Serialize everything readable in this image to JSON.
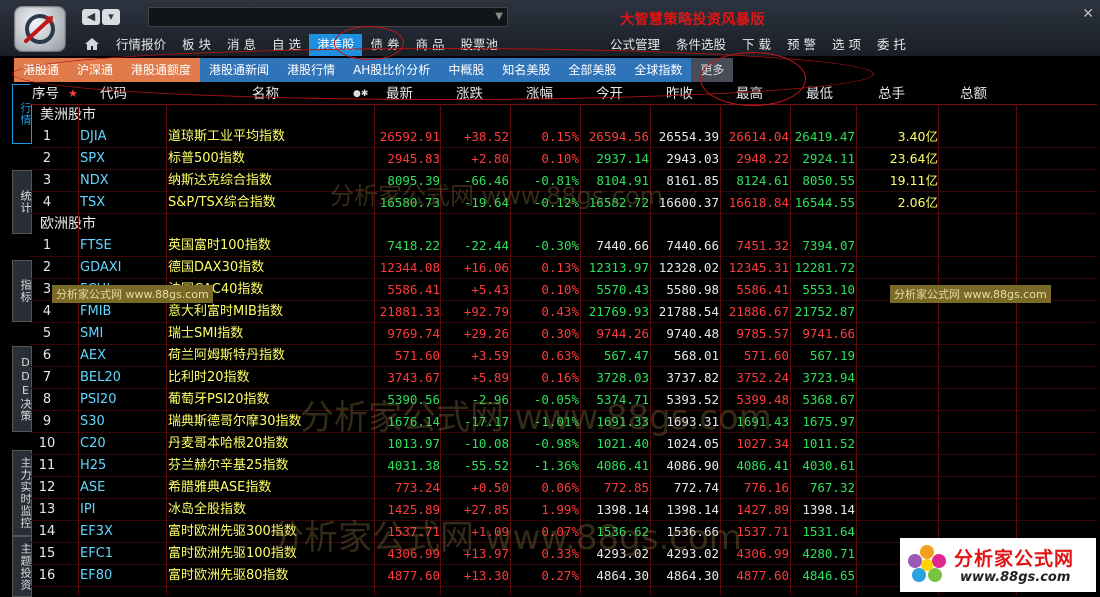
{
  "app": {
    "title": "大智慧策略投资风暴版"
  },
  "menu": [
    "行情报价",
    "板 块",
    "消 息",
    "自 选",
    "港美股",
    "债 券",
    "商 品",
    "股票池",
    "公式管理",
    "条件选股",
    "下 载",
    "预 警",
    "选 项",
    "委 托"
  ],
  "active_menu": "港美股",
  "subtabs": [
    {
      "label": "港股通",
      "style": "orange"
    },
    {
      "label": "沪深通",
      "style": "orange"
    },
    {
      "label": "港股通额度",
      "style": "orange"
    },
    {
      "label": "港股通新闻",
      "style": "blue"
    },
    {
      "label": "港股行情",
      "style": "blue"
    },
    {
      "label": "AH股比价分析",
      "style": "blue"
    },
    {
      "label": "中概股",
      "style": "blue"
    },
    {
      "label": "知名美股",
      "style": "blue"
    },
    {
      "label": "全部美股",
      "style": "blue"
    },
    {
      "label": "全球指数",
      "style": "blue"
    },
    {
      "label": "更多",
      "style": "more"
    }
  ],
  "side_tabs": [
    {
      "label": "行情",
      "active": true
    },
    {
      "label": "统计",
      "active": false
    },
    {
      "label": "指标",
      "active": false
    },
    {
      "label": "DDE决策",
      "active": false
    },
    {
      "label": "主力实时监控",
      "active": false
    },
    {
      "label": "主题投资",
      "active": false
    }
  ],
  "table": {
    "columns": [
      "序号",
      "代码",
      "名称",
      "最新",
      "涨跌",
      "涨幅",
      "今开",
      "昨收",
      "最高",
      "最低",
      "总手",
      "总额"
    ],
    "sections": [
      {
        "title": "美洲股市",
        "rows": [
          {
            "no": "1",
            "code": "DJIA",
            "name": "道琼斯工业平均指数",
            "last": "26592.91",
            "chg": "+38.52",
            "pct": "0.15%",
            "open": "26594.56",
            "prev": "26554.39",
            "high": "26614.04",
            "low": "26419.47",
            "vol": "3.40亿",
            "dir": "up"
          },
          {
            "no": "2",
            "code": "SPX",
            "name": "标普500指数",
            "last": "2945.83",
            "chg": "+2.80",
            "pct": "0.10%",
            "open": "2937.14",
            "prev": "2943.03",
            "high": "2948.22",
            "low": "2924.11",
            "vol": "23.64亿",
            "dir": "up"
          },
          {
            "no": "3",
            "code": "NDX",
            "name": "纳斯达克综合指数",
            "last": "8095.39",
            "chg": "-66.46",
            "pct": "-0.81%",
            "open": "8104.91",
            "prev": "8161.85",
            "high": "8124.61",
            "low": "8050.55",
            "vol": "19.11亿",
            "dir": "down"
          },
          {
            "no": "4",
            "code": "TSX",
            "name": "S&P/TSX综合指数",
            "last": "16580.73",
            "chg": "-19.64",
            "pct": "-0.12%",
            "open": "16582.72",
            "prev": "16600.37",
            "high": "16618.84",
            "low": "16544.55",
            "vol": "2.06亿",
            "dir": "down"
          }
        ]
      },
      {
        "title": "欧洲股市",
        "rows": [
          {
            "no": "1",
            "code": "FTSE",
            "name": "英国富时100指数",
            "last": "7418.22",
            "chg": "-22.44",
            "pct": "-0.30%",
            "open": "7440.66",
            "prev": "7440.66",
            "high": "7451.32",
            "low": "7394.07",
            "vol": "",
            "dir": "down"
          },
          {
            "no": "2",
            "code": "GDAXI",
            "name": "德国DAX30指数",
            "last": "12344.08",
            "chg": "+16.06",
            "pct": "0.13%",
            "open": "12313.97",
            "prev": "12328.02",
            "high": "12345.31",
            "low": "12281.72",
            "vol": "",
            "dir": "up"
          },
          {
            "no": "3",
            "code": "FCHI",
            "name": "法国CAC40指数",
            "last": "5586.41",
            "chg": "+5.43",
            "pct": "0.10%",
            "open": "5570.43",
            "prev": "5580.98",
            "high": "5586.41",
            "low": "5553.10",
            "vol": "",
            "dir": "up"
          },
          {
            "no": "4",
            "code": "FMIB",
            "name": "意大利富时MIB指数",
            "last": "21881.33",
            "chg": "+92.79",
            "pct": "0.43%",
            "open": "21769.93",
            "prev": "21788.54",
            "high": "21886.67",
            "low": "21752.87",
            "vol": "",
            "dir": "up"
          },
          {
            "no": "5",
            "code": "SMI",
            "name": "瑞士SMI指数",
            "last": "9769.74",
            "chg": "+29.26",
            "pct": "0.30%",
            "open": "9744.26",
            "prev": "9740.48",
            "high": "9785.57",
            "low": "9741.66",
            "vol": "",
            "dir": "up"
          },
          {
            "no": "6",
            "code": "AEX",
            "name": "荷兰阿姆斯特丹指数",
            "last": "571.60",
            "chg": "+3.59",
            "pct": "0.63%",
            "open": "567.47",
            "prev": "568.01",
            "high": "571.60",
            "low": "567.19",
            "vol": "",
            "dir": "up"
          },
          {
            "no": "7",
            "code": "BEL20",
            "name": "比利时20指数",
            "last": "3743.67",
            "chg": "+5.89",
            "pct": "0.16%",
            "open": "3728.03",
            "prev": "3737.82",
            "high": "3752.24",
            "low": "3723.94",
            "vol": "",
            "dir": "up"
          },
          {
            "no": "8",
            "code": "PSI20",
            "name": "葡萄牙PSI20指数",
            "last": "5390.56",
            "chg": "-2.96",
            "pct": "-0.05%",
            "open": "5374.71",
            "prev": "5393.52",
            "high": "5399.48",
            "low": "5368.67",
            "vol": "",
            "dir": "down"
          },
          {
            "no": "9",
            "code": "S30",
            "name": "瑞典斯德哥尔摩30指数",
            "last": "1676.14",
            "chg": "-17.17",
            "pct": "-1.01%",
            "open": "1691.33",
            "prev": "1693.31",
            "high": "1691.43",
            "low": "1675.97",
            "vol": "",
            "dir": "down"
          },
          {
            "no": "10",
            "code": "C20",
            "name": "丹麦哥本哈根20指数",
            "last": "1013.97",
            "chg": "-10.08",
            "pct": "-0.98%",
            "open": "1021.40",
            "prev": "1024.05",
            "high": "1027.34",
            "low": "1011.52",
            "vol": "",
            "dir": "down"
          },
          {
            "no": "11",
            "code": "H25",
            "name": "芬兰赫尔辛基25指数",
            "last": "4031.38",
            "chg": "-55.52",
            "pct": "-1.36%",
            "open": "4086.41",
            "prev": "4086.90",
            "high": "4086.41",
            "low": "4030.61",
            "vol": "",
            "dir": "down"
          },
          {
            "no": "12",
            "code": "ASE",
            "name": "希腊雅典ASE指数",
            "last": "773.24",
            "chg": "+0.50",
            "pct": "0.06%",
            "open": "772.85",
            "prev": "772.74",
            "high": "776.16",
            "low": "767.32",
            "vol": "",
            "dir": "up"
          },
          {
            "no": "13",
            "code": "IPI",
            "name": "冰岛全股指数",
            "last": "1425.89",
            "chg": "+27.85",
            "pct": "1.99%",
            "open": "1398.14",
            "prev": "1398.14",
            "high": "1427.89",
            "low": "1398.14",
            "vol": "",
            "dir": "up"
          },
          {
            "no": "14",
            "code": "EF3X",
            "name": "富时欧洲先驱300指数",
            "last": "1537.71",
            "chg": "+1.09",
            "pct": "0.07%",
            "open": "1536.62",
            "prev": "1536.66",
            "high": "1537.71",
            "low": "1531.64",
            "vol": "",
            "dir": "up"
          },
          {
            "no": "15",
            "code": "EFC1",
            "name": "富时欧洲先驱100指数",
            "last": "4306.99",
            "chg": "+13.97",
            "pct": "0.33%",
            "open": "4293.02",
            "prev": "4293.02",
            "high": "4306.99",
            "low": "4280.71",
            "vol": "",
            "dir": "up"
          },
          {
            "no": "16",
            "code": "EF80",
            "name": "富时欧洲先驱80指数",
            "last": "4877.60",
            "chg": "+13.30",
            "pct": "0.27%",
            "open": "4864.30",
            "prev": "4864.30",
            "high": "4877.60",
            "low": "4846.65",
            "vol": "",
            "dir": "up"
          }
        ]
      }
    ]
  },
  "watermark": {
    "text": "分析家公式网 www.88gs.com",
    "box_text": "分析家公式网 www.88gs.com"
  },
  "brand": {
    "name": "分析家公式网",
    "url": "www.88gs.com"
  },
  "colors": {
    "up": "#ff3a3a",
    "down": "#2ee05a",
    "flat": "#e8e8e8",
    "code": "#62d6ff",
    "name": "#ffff66",
    "vol": "#ffff66",
    "accent": "#1f8fe0"
  }
}
